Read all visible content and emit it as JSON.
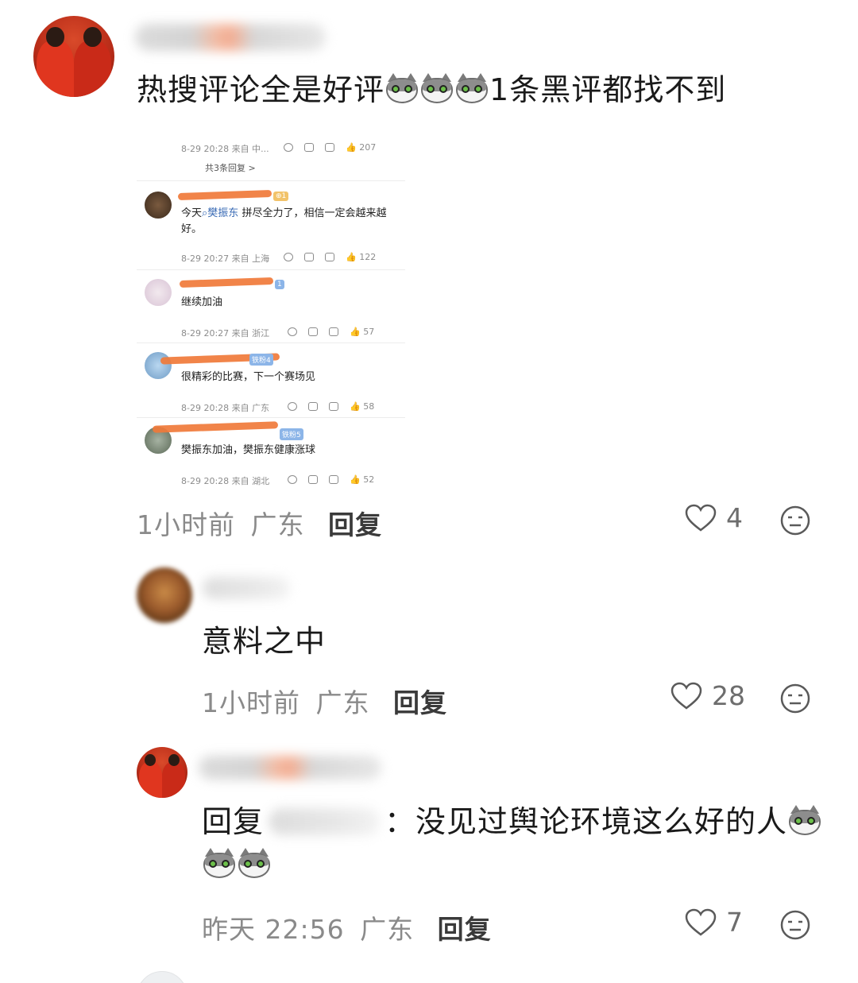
{
  "comments": [
    {
      "text": "热搜评论全是好评",
      "text_after": "1条黑评都找不到",
      "emoji_count": 3,
      "time": "1小时前",
      "location": "广东",
      "reply_label": "回复",
      "likes": "4",
      "image": {
        "top_meta": {
          "time": "8-29 20:28 来自 中...",
          "likes": "207"
        },
        "replies_link": "共3条回复 >",
        "items": [
          {
            "body_prefix": "今天",
            "body_link": "樊振东",
            "body_suffix": "拼尽全力了，相信一定会越来越好。",
            "meta": "8-29 20:27 来自 上海",
            "likes": "122"
          },
          {
            "body": "继续加油",
            "meta": "8-29 20:27 来自 浙江",
            "likes": "57",
            "badge": "1"
          },
          {
            "body": "很精彩的比赛，下一个赛场见",
            "meta": "8-29 20:28 来自 广东",
            "likes": "58",
            "badge": "铁粉4"
          },
          {
            "body": "樊振东加油，樊振东健康涨球",
            "meta": "8-29 20:28 来自 湖北",
            "likes": "52",
            "badge": "铁粉5"
          }
        ]
      }
    },
    {
      "text": "意料之中",
      "time": "1小时前",
      "location": "广东",
      "reply_label": "回复",
      "likes": "28"
    },
    {
      "reply_prefix": "回复",
      "text": "：没见过舆论环境这么好的人",
      "emoji_count_inline": 1,
      "emoji_count_next_line": 2,
      "time": "昨天 22:56",
      "location": "广东",
      "reply_label": "回复",
      "likes": "7"
    }
  ],
  "colors": {
    "meta_grey": "#8a8a8a",
    "scribble": "#f07a3a",
    "link_blue": "#3a6bb5"
  }
}
